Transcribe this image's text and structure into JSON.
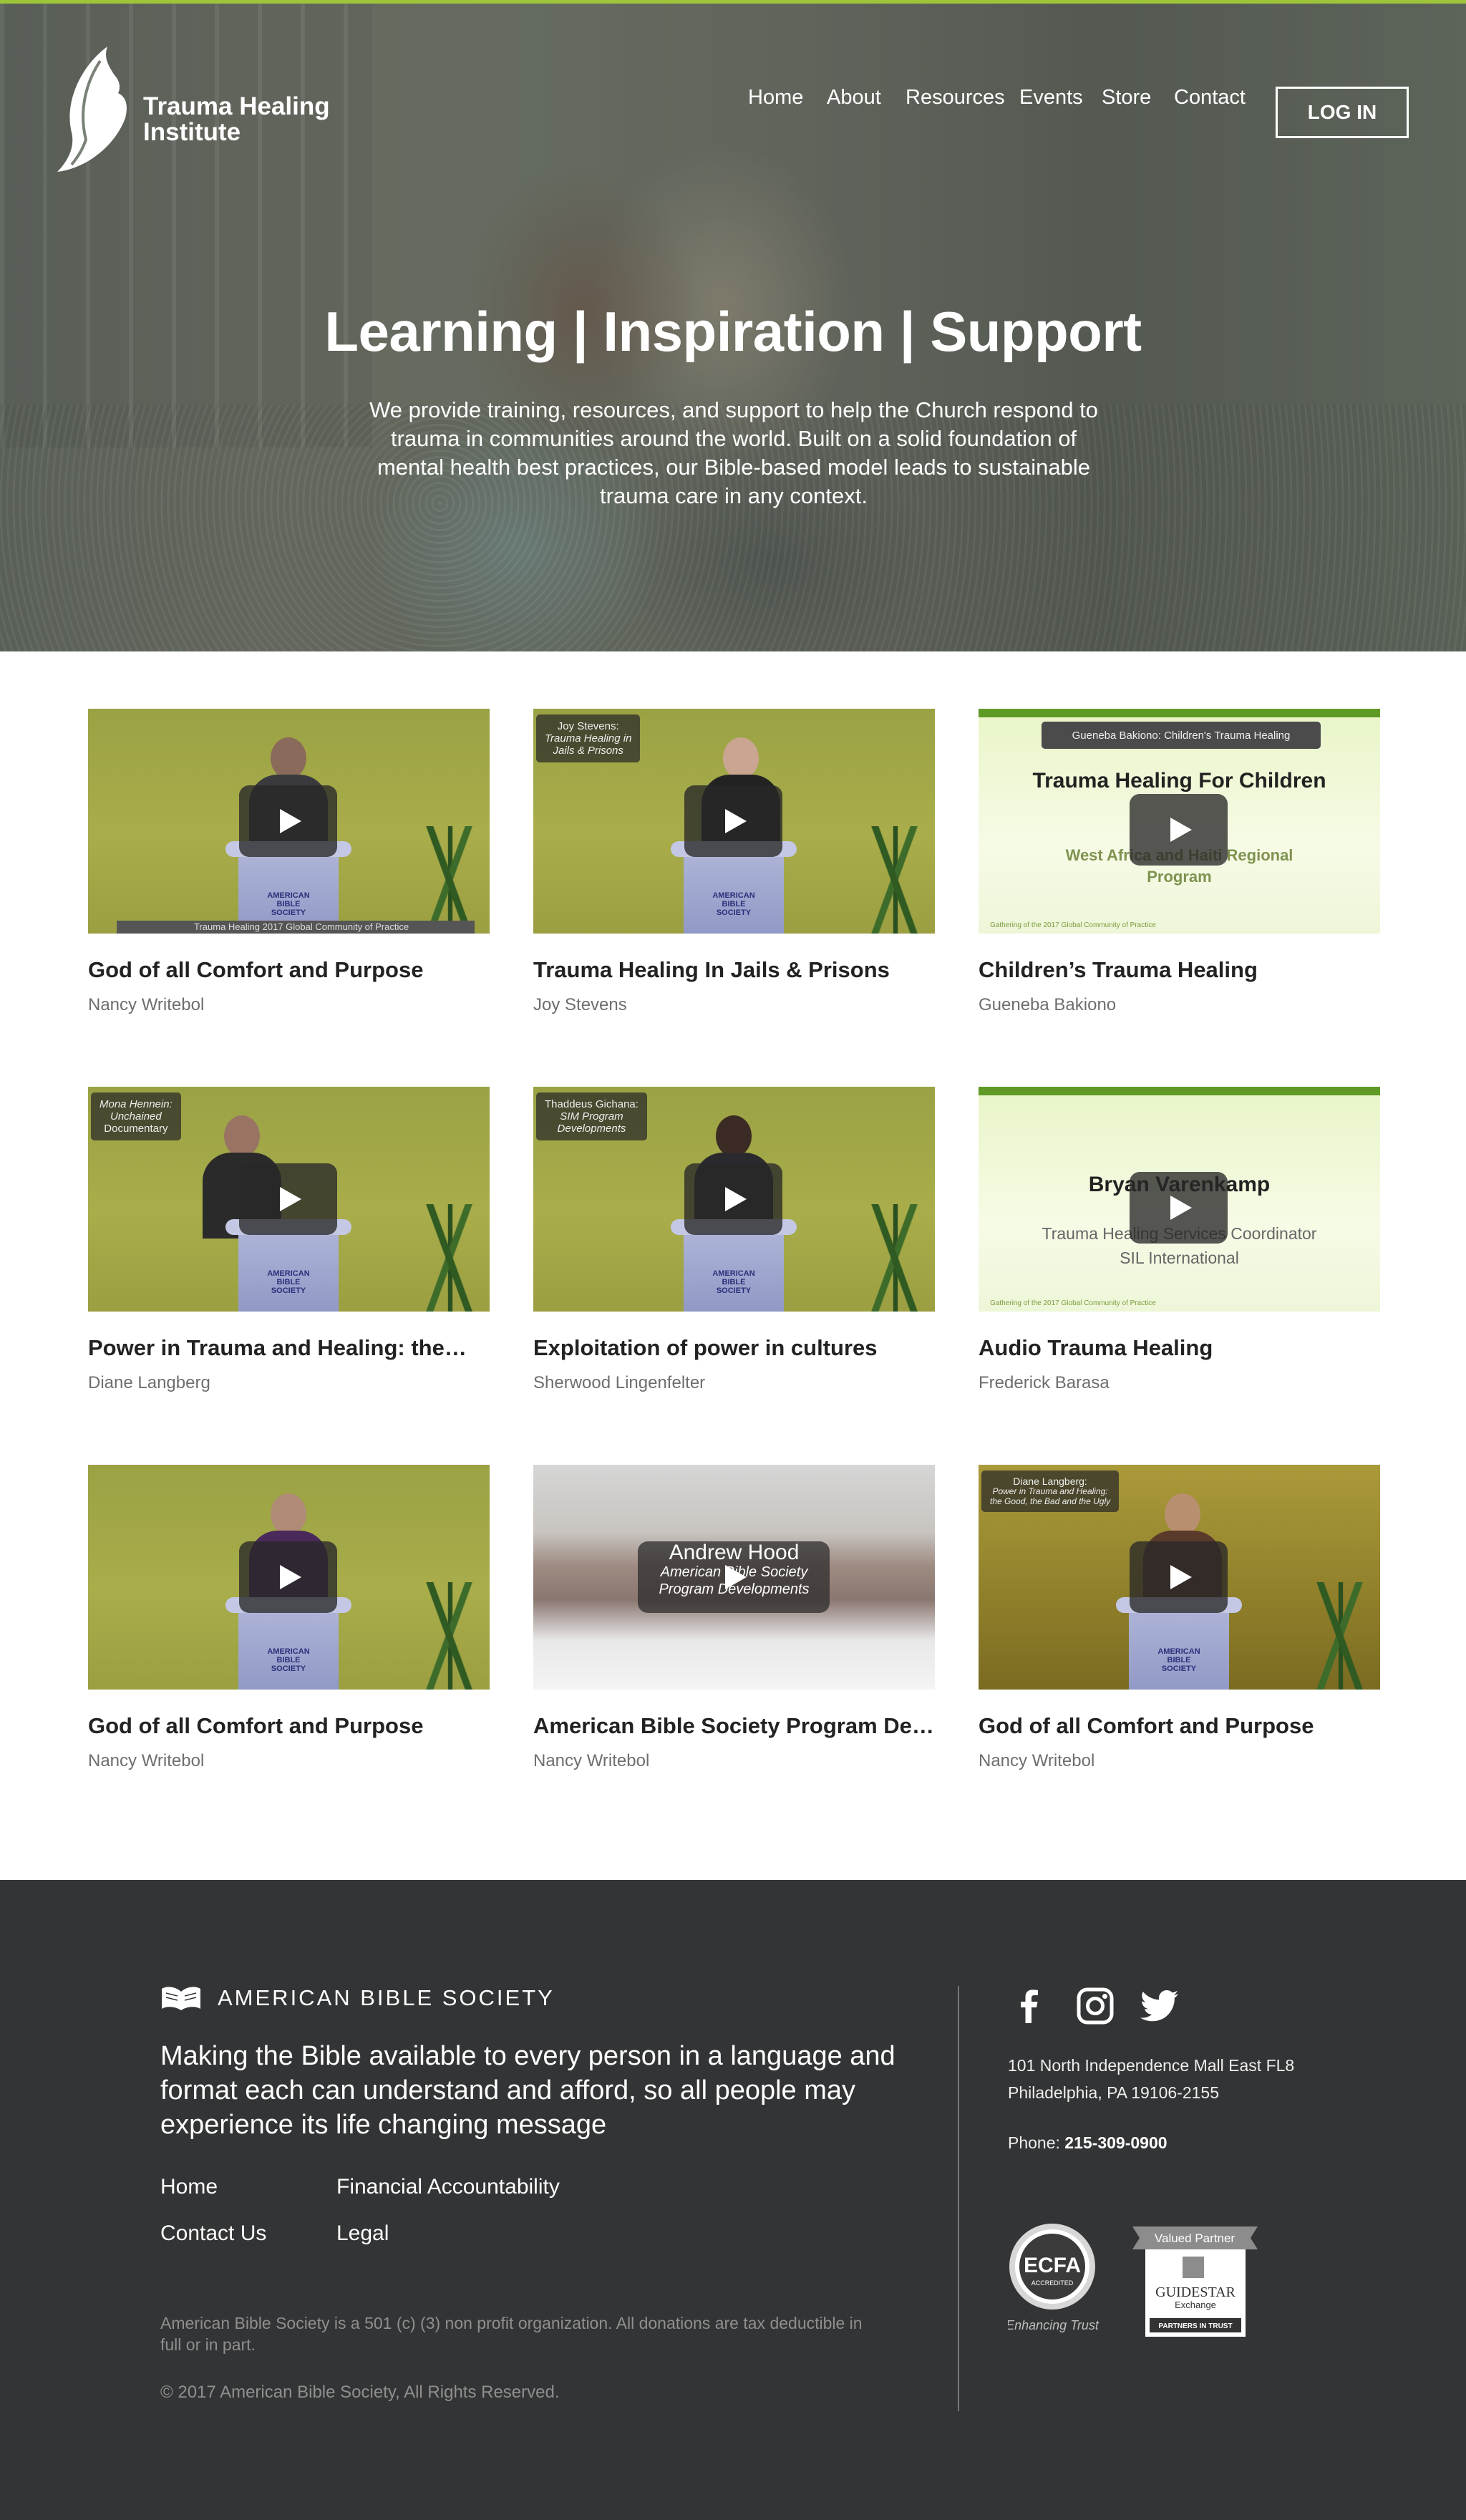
{
  "site": {
    "logo_line1": "Trauma Healing",
    "logo_line2": "Institute",
    "accent": "#9ec43a"
  },
  "nav": {
    "items": [
      "Home",
      "About",
      "Resources",
      "Events",
      "Store",
      "Contact"
    ],
    "login": "LOG IN"
  },
  "hero": {
    "title": "Learning | Inspiration | Support",
    "text": "We provide training, resources, and support to help the Church respond to trauma in communities around the world. Built on a solid foundation of mental health best practices, our Bible-based model leads to sustainable trauma care in any context."
  },
  "videos": [
    {
      "title": "God of all Comfort and Purpose",
      "author": "Nancy Writebol",
      "lower_third": "Trauma Healing  2017 Global Community of Practice"
    },
    {
      "title": "Trauma Healing In Jails & Prisons",
      "author": "Joy Stevens",
      "tag_line1": "Joy Stevens:",
      "tag_line2": "Trauma Healing in",
      "tag_line3": "Jails & Prisons"
    },
    {
      "title": "Children’s Trauma Healing",
      "author": "Gueneba Bakiono",
      "pill": "Gueneba Bakiono: Children's Trauma Healing",
      "slide_title": "Trauma Healing For Children",
      "slide_sub1": "West Africa and Haiti Regional",
      "slide_sub2": "Program",
      "slide_foot": "Gathering of the 2017 Global Community of Practice"
    },
    {
      "title": "Power in Trauma and Healing: the…",
      "author": "Diane Langberg",
      "tag_line1": "Mona Hennein:",
      "tag_line2": "Unchained",
      "tag_line3": "Documentary"
    },
    {
      "title": "Exploitation of power in cultures",
      "author": "Sherwood Lingenfelter",
      "tag_line1": "Thaddeus Gichana:",
      "tag_line2": "SIM Program",
      "tag_line3": "Developments"
    },
    {
      "title": "Audio Trauma Healing",
      "author": "Frederick Barasa",
      "slide_title": "Bryan Varenkamp",
      "slide_sub1": "Trauma Healing Services Coordinator",
      "slide_sub2": "SIL International",
      "slide_foot": "Gathering of the 2017 Global Community of Practice"
    },
    {
      "title": "God of all Comfort and Purpose",
      "author": "Nancy Writebol"
    },
    {
      "title": "American Bible Society Program  De…",
      "author": "Nancy Writebol",
      "city_line1": "Andrew Hood",
      "city_line2": "American Bible Society",
      "city_line3": "Program Developments"
    },
    {
      "title": "God of all Comfort and Purpose",
      "author": "Nancy Writebol",
      "tag_line1": "Diane Langberg:",
      "tag_line2": "Power in Trauma and Healing:",
      "tag_line3": "the Good, the Bad and the Ugly"
    }
  ],
  "podium": {
    "line1": "AMERICAN",
    "line2": "BIBLE",
    "line3": "SOCIETY"
  },
  "footer": {
    "org_name": "AMERICAN BIBLE SOCIETY",
    "mission": "Making the Bible available to every person in a language and format each can understand and afford, so all people may experience its life changing message",
    "links": [
      "Home",
      "Financial Accountability",
      "Contact Us",
      "Legal"
    ],
    "legal": "American Bible Society is a 501 (c) (3) non profit organization. All donations are tax deductible in full or in part.",
    "copyright": "© 2017 American Bible Society, All Rights Reserved.",
    "address_line1": "101 North Independence Mall East FL8",
    "address_line2": "Philadelphia, PA 19106-2155",
    "phone_label": "Phone:",
    "phone": "215-309-0900",
    "ecfa_text": "ECFA",
    "ecfa_sub": "ACCREDITED",
    "ecfa_tagline": "Enhancing Trust",
    "guidestar_top": "Valued Partner",
    "guidestar_name": "GUIDESTAR",
    "guidestar_sub": "Exchange",
    "guidestar_bottom": "PARTNERS IN TRUST"
  }
}
